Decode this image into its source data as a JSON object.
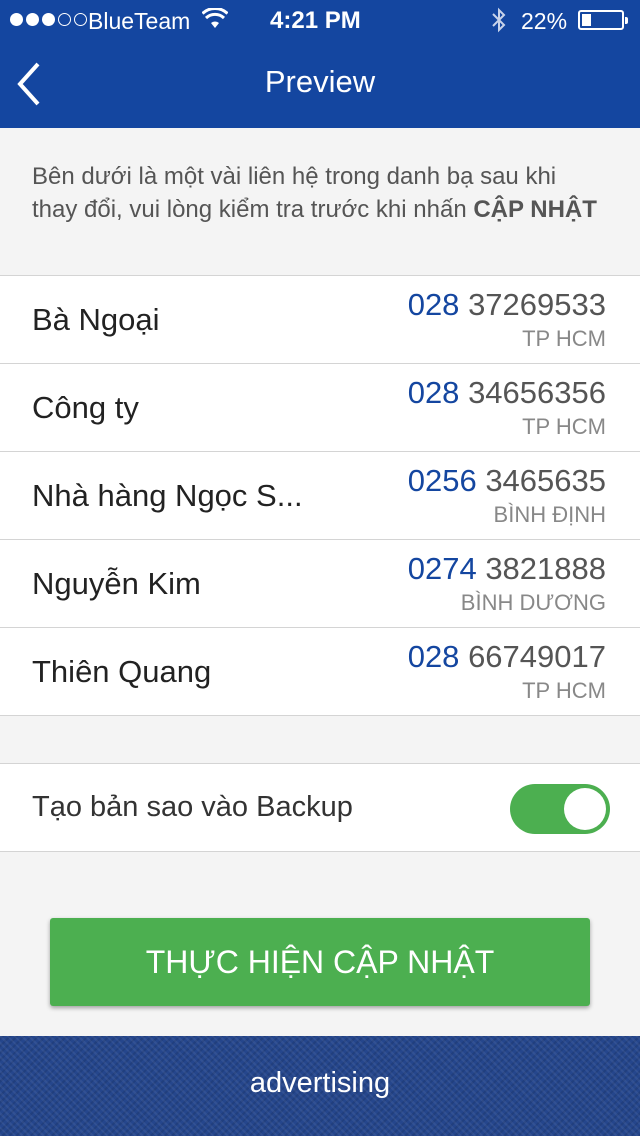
{
  "status_bar": {
    "carrier": "BlueTeam",
    "time": "4:21 PM",
    "battery_percent": "22%",
    "signal_bars_filled": 3,
    "signal_bars_total": 5
  },
  "nav": {
    "title": "Preview",
    "back_icon": "chevron-left-icon"
  },
  "description": {
    "text": "Bên dưới là một vài liên hệ trong danh bạ sau khi thay đổi, vui lòng kiểm tra trước khi nhấn ",
    "bold": "CẬP NHẬT"
  },
  "contacts": [
    {
      "name": "Bà Ngoại",
      "prefix": "028",
      "number": "37269533",
      "region": "TP HCM"
    },
    {
      "name": "Công ty",
      "prefix": "028",
      "number": "34656356",
      "region": "TP HCM"
    },
    {
      "name": "Nhà hàng Ngọc S...",
      "prefix": "0256",
      "number": "3465635",
      "region": "BÌNH ĐỊNH"
    },
    {
      "name": "Nguyễn Kim",
      "prefix": "0274",
      "number": "3821888",
      "region": "BÌNH DƯƠNG"
    },
    {
      "name": "Thiên Quang",
      "prefix": "028",
      "number": "66749017",
      "region": "TP HCM"
    }
  ],
  "backup": {
    "label": "Tạo bản sao vào Backup",
    "enabled": true
  },
  "update_button": {
    "label": "THỰC HIỆN CẬP NHẬT"
  },
  "ad": {
    "text": "advertising"
  },
  "colors": {
    "header": "#1446a0",
    "accent_green": "#4caf50",
    "prefix_blue": "#1446a0"
  }
}
